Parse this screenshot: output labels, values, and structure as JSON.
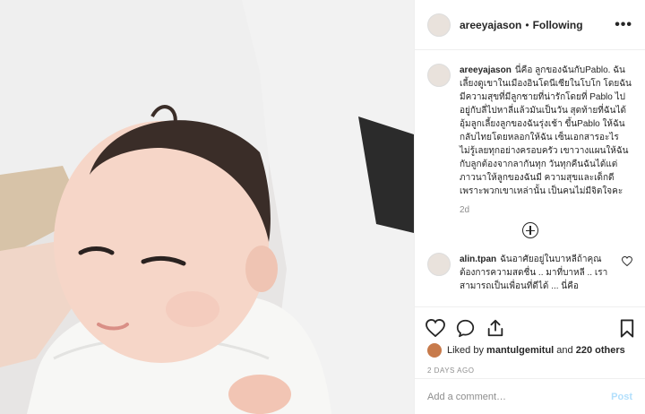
{
  "post": {
    "image_alt": "baby photo",
    "header": {
      "username": "areeyajason",
      "separator": "•",
      "follow_label": "Following",
      "more_label": "•••"
    },
    "caption": {
      "username": "areeyajason",
      "text": "นี่คือ ลูกของฉันกับPablo. ฉันเลี้ยงดูเขาในเมืองอินโดนีเซียในโบโก โดยฉันมีความสุขที่มีลูกชายที่น่ารักโดยที่ Pablo ไปอยู่กับลี่ไปหาลี่แล้วมันเป็นวัน สุดท้ายที่ฉันได้อุ้มลูกเลี้ยงลูกของฉันรุ่งเช้า ขึ้นPablo ให้ฉันกลับไทยโดยหลอกให้ฉัน เซ็นเอกสารอะไรไม่รู้เลยทุกอย่างครอบครัว เขาวางแผนให้ฉันกับลูกต้องจากลากันทุก วันทุกคืนฉันได้แต่ภาวนาให้ลูกของฉันมี ความสุขและเด็กดี เพราะพวกเขาเหล่านั้น เป็นคนไม่มีจิตใจคะ",
      "time": "2d"
    },
    "comment": {
      "username": "alin.tpan",
      "text": "ฉันอาศัยอยู่ในบาหลีถ้าคุณ ต้องการความสดชื่น .. มาที่บาหลี .. เราสามารถเป็นเพื่อนที่ดีได้ ... นี่คือ"
    },
    "likes": {
      "prefix": "Liked by",
      "user": "mantulgemitul",
      "and": "and",
      "others": "220 others"
    },
    "ago": "2 DAYS AGO",
    "add_comment": {
      "placeholder": "Add a comment…",
      "post_label": "Post"
    }
  },
  "colors": {
    "accent_post_disabled": "#b2dffc",
    "muted": "#8e8e8e",
    "text": "#262626",
    "border": "#efefef"
  }
}
